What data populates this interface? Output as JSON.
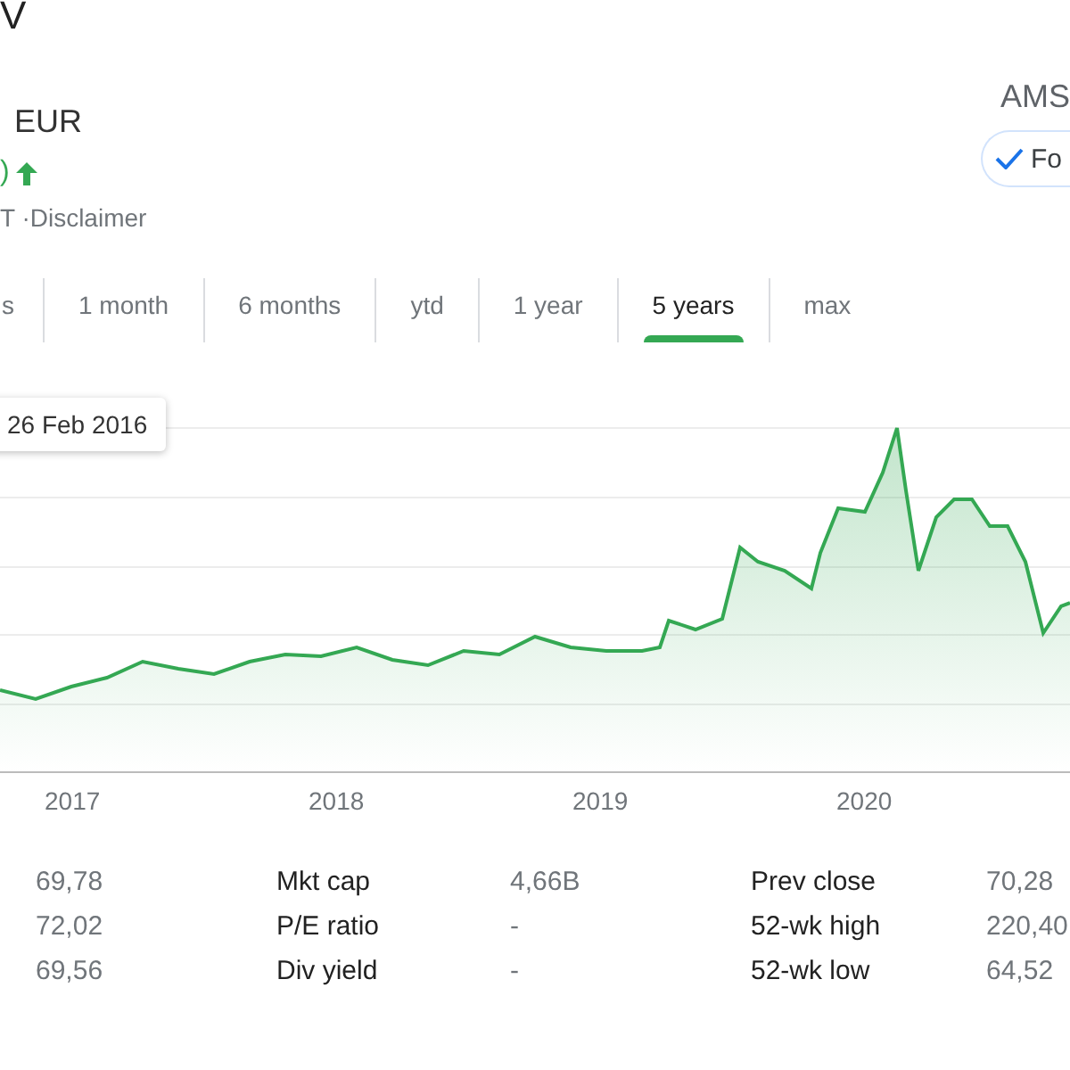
{
  "header": {
    "title": "V",
    "currency": "EUR",
    "change": ")",
    "disclaimer": "T ·Disclaimer",
    "exchange": "AMS",
    "follow_button": "Fo"
  },
  "tabs": [
    {
      "label": "s",
      "selected": false
    },
    {
      "label": "1 month",
      "selected": false
    },
    {
      "label": "6 months",
      "selected": false
    },
    {
      "label": "ytd",
      "selected": false
    },
    {
      "label": "1 year",
      "selected": false
    },
    {
      "label": "5 years",
      "selected": true
    },
    {
      "label": "max",
      "selected": false
    }
  ],
  "chart": {
    "tooltip": "26 Feb 2016",
    "x_labels": [
      "2017",
      "2018",
      "2019",
      "2020"
    ]
  },
  "stats": [
    [
      "69,78",
      "Mkt cap",
      "4,66B",
      "Prev close",
      "70,28"
    ],
    [
      "72,02",
      "P/E ratio",
      "-",
      "52-wk high",
      "220,40"
    ],
    [
      "69,56",
      "Div yield",
      "-",
      "52-wk low",
      "64,52"
    ]
  ]
}
